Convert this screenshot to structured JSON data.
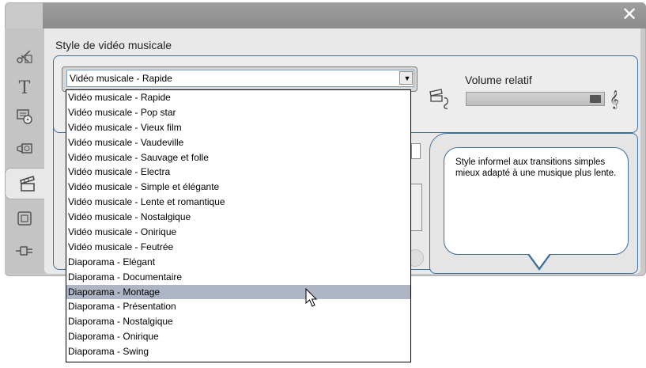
{
  "window": {
    "close_glyph": "✕"
  },
  "toolstrip": {
    "tools": [
      {
        "name": "video-edit-icon",
        "glyph": "✂"
      },
      {
        "name": "title-icon",
        "glyph": "T"
      },
      {
        "name": "menu-disc-icon",
        "glyph": "▤"
      },
      {
        "name": "camera-icon",
        "glyph": "◙"
      },
      {
        "name": "smart-movie-icon",
        "glyph": "🎬"
      },
      {
        "name": "frame-icon",
        "glyph": "▣"
      },
      {
        "name": "plugin-icon",
        "glyph": "⊣"
      }
    ],
    "active_index": 4
  },
  "section_label": "Style de vidéo musicale",
  "style_combo": {
    "value": "Vidéo musicale - Rapide",
    "arrow": "▼",
    "options": [
      "Vidéo musicale - Rapide",
      "Vidéo musicale - Pop star",
      "Vidéo musicale - Vieux film",
      "Vidéo musicale - Vaudeville",
      "Vidéo musicale - Sauvage et folle",
      "Vidéo musicale - Electra",
      "Vidéo musicale - Simple et élégante",
      "Vidéo musicale - Lente et romantique",
      "Vidéo musicale - Nostalgique",
      "Vidéo musicale - Onirique",
      "Vidéo musicale - Feutrée",
      "Diaporama - Elégant",
      "Diaporama - Documentaire",
      "Diaporama - Montage",
      "Diaporama - Présentation",
      "Diaporama - Nostalgique",
      "Diaporama - Onirique",
      "Diaporama - Swing"
    ],
    "highlighted": "Diaporama - Montage"
  },
  "volume": {
    "label": "Volume relatif",
    "level": 1.0,
    "left_icon": "camera-audio-icon",
    "right_icon": "music-note-icon"
  },
  "description": "Style informel aux transitions simples mieux adapté à une musique plus lente."
}
